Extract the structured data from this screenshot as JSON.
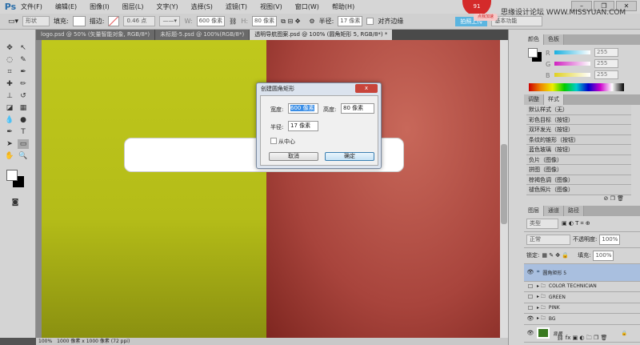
{
  "menubar": {
    "app_logo": "Ps",
    "items": [
      "文件(F)",
      "编辑(E)",
      "图像(I)",
      "图层(L)",
      "文字(Y)",
      "选择(S)",
      "滤镜(T)",
      "视图(V)",
      "窗口(W)",
      "帮助(H)"
    ],
    "badge": "91",
    "badge_label": "点我加速",
    "watermark": "思缘设计论坛 WWW.MISSYUAN.COM"
  },
  "options": {
    "mode": "形状",
    "fill_label": "填充:",
    "stroke_label": "描边:",
    "stroke_width": "0.46 点",
    "w_label": "W:",
    "w_value": "600 像素",
    "h_label": "H:",
    "h_value": "80 像素",
    "radius_label": "半径:",
    "radius_value": "17 像素",
    "align_edges": "对齐边缘",
    "upload": "拍照上传",
    "workspace": "基本功能"
  },
  "tabs": [
    "logo.psd @ 50% (矢量智能对象, RGB/8*)",
    "未标题-5.psd @ 100%(RGB/8*)",
    "透明导航图案.psd @ 100% (圆角矩形 5, RGB/8*) *"
  ],
  "dialog": {
    "title": "创建圆角矩形",
    "width_label": "宽度:",
    "width_value": "600 像素",
    "height_label": "高度:",
    "height_value": "80 像素",
    "radius_label": "半径:",
    "radius_value": "17 像素",
    "from_center": "从中心",
    "cancel": "取消",
    "ok": "确定"
  },
  "status": {
    "zoom": "100%",
    "doc": "1000 像素 x 1000 像素 (72 ppi)"
  },
  "color_panel": {
    "tabs": [
      "颜色",
      "色板"
    ],
    "r_label": "R",
    "g_label": "G",
    "b_label": "B",
    "r": "255",
    "g": "255",
    "b": "255"
  },
  "styles_panel": {
    "tabs": [
      "调整",
      "样式"
    ],
    "items": [
      "默认样式（无）",
      "彩色目标（按钮）",
      "双环发光（按钮）",
      "条纹的锥形（按钮）",
      "蓝色玻璃（按钮）",
      "负片（图像）",
      "拼图（图像）",
      "棕褐色调（图像）",
      "褪色照片（图像）"
    ]
  },
  "layers_panel": {
    "tabs": [
      "图层",
      "通道",
      "路径"
    ],
    "filter": "类型",
    "blend": "正常",
    "opacity_label": "不透明度:",
    "opacity": "100%",
    "lock_label": "锁定:",
    "fill_label": "填充:",
    "fill": "100%",
    "layers": [
      {
        "name": "圆角矩形 5",
        "visible": true,
        "type": "shape"
      },
      {
        "name": "COLOR TECHNICIAN",
        "visible": false,
        "type": "group"
      },
      {
        "name": "GREEN",
        "visible": false,
        "type": "group"
      },
      {
        "name": "PINK",
        "visible": false,
        "type": "group"
      },
      {
        "name": "BG",
        "visible": true,
        "type": "group"
      },
      {
        "name": "背景",
        "visible": true,
        "type": "background"
      }
    ]
  },
  "colors": {
    "left_panel": "#b8c01a",
    "right_panel": "#b04a40",
    "accent": "#2b6ea8"
  }
}
